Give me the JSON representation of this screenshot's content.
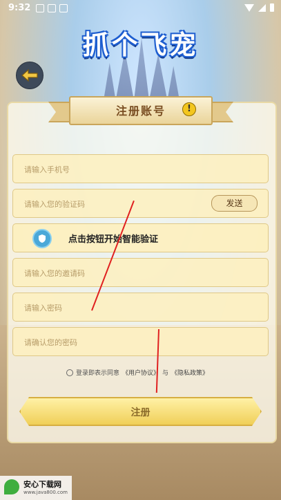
{
  "status_bar": {
    "time": "9:32"
  },
  "app": {
    "logo_text": "抓个飞宠"
  },
  "form": {
    "title": "注册账号",
    "phone_placeholder": "请输入手机号",
    "code_placeholder": "请输入您的验证码",
    "send_label": "发送",
    "verify_label": "点击按钮开始智能验证",
    "invite_placeholder": "请输入您的邀请码",
    "password_placeholder": "请输入密码",
    "confirm_placeholder": "请确认您的密码",
    "agree_prefix": "登录即表示同意",
    "user_agreement": "《用户协议》",
    "agree_and": "与",
    "privacy_policy": "《隐私政策》",
    "register_label": "注册"
  },
  "watermark": {
    "main": "安心下载网",
    "sub": "www.java800.com"
  },
  "icons": [
    "back-arrow-icon",
    "warning-icon",
    "shield-check-icon",
    "wifi-icon",
    "signal-icon",
    "battery-icon"
  ],
  "colors": {
    "accent": "#f0cf58",
    "title": "#7a4e22",
    "arrow": "#e02020"
  }
}
